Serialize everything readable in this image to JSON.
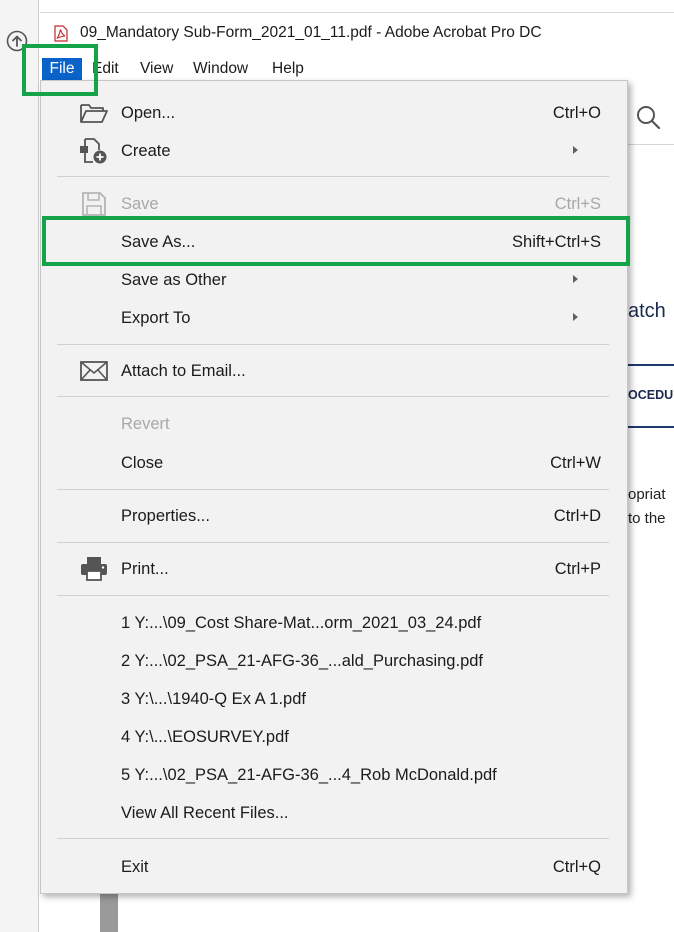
{
  "window": {
    "title": "09_Mandatory Sub-Form_2021_01_11.pdf - Adobe Acrobat Pro DC",
    "icon": "pdf-icon",
    "left_strip_icon": "upload-arrow-icon"
  },
  "menubar": {
    "items": [
      "File",
      "Edit",
      "View",
      "Window",
      "Help"
    ],
    "active": "File",
    "active_color": "#0a63c9"
  },
  "background_document": {
    "toolbar_icon": "search-icon",
    "heading_fragment": "atch",
    "section_fragment": "OCEDU",
    "text_line_1": "opriat",
    "text_line_2": "to the"
  },
  "file_menu": {
    "items": [
      {
        "label": "Open...",
        "shortcut": "Ctrl+O",
        "icon": "folder-open-icon",
        "enabled": true
      },
      {
        "label": "Create",
        "shortcut": "",
        "icon": "create-pdf-icon",
        "enabled": true,
        "submenu": true
      },
      {
        "label": "Save",
        "shortcut": "Ctrl+S",
        "icon": "save-disk-icon",
        "enabled": false
      },
      {
        "label": "Save As...",
        "shortcut": "Shift+Ctrl+S",
        "enabled": true,
        "highlighted": true
      },
      {
        "label": "Save as Other",
        "shortcut": "",
        "enabled": true,
        "submenu": true
      },
      {
        "label": "Export To",
        "shortcut": "",
        "enabled": true,
        "submenu": true
      },
      {
        "label": "Attach to Email...",
        "shortcut": "",
        "icon": "envelope-icon",
        "enabled": true
      },
      {
        "label": "Revert",
        "shortcut": "",
        "enabled": false
      },
      {
        "label": "Close",
        "shortcut": "Ctrl+W",
        "enabled": true
      },
      {
        "label": "Properties...",
        "shortcut": "Ctrl+D",
        "enabled": true
      },
      {
        "label": "Print...",
        "shortcut": "Ctrl+P",
        "icon": "printer-icon",
        "enabled": true
      },
      {
        "label": "1 Y:...\\09_Cost Share-Mat...orm_2021_03_24.pdf",
        "enabled": true
      },
      {
        "label": "2 Y:...\\02_PSA_21-AFG-36_...ald_Purchasing.pdf",
        "enabled": true
      },
      {
        "label": "3 Y:\\...\\1940-Q Ex A 1.pdf",
        "enabled": true
      },
      {
        "label": "4 Y:\\...\\EOSURVEY.pdf",
        "enabled": true
      },
      {
        "label": "5 Y:...\\02_PSA_21-AFG-36_...4_Rob McDonald.pdf",
        "enabled": true
      },
      {
        "label": "View All Recent Files...",
        "enabled": true
      },
      {
        "label": "Exit",
        "shortcut": "Ctrl+Q",
        "enabled": true
      }
    ]
  },
  "annotations": {
    "highlight_color": "#15a34a",
    "highlighted_targets": [
      "File",
      "Save As..."
    ]
  }
}
